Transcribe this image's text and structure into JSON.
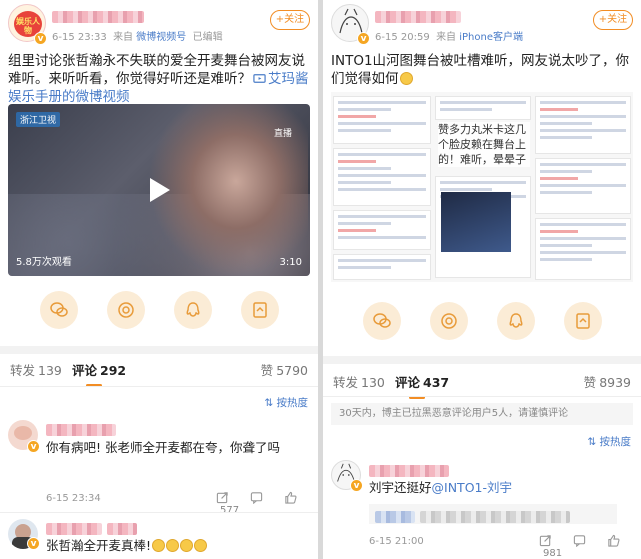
{
  "left": {
    "header": {
      "time": "6-15 23:33",
      "source_prefix": "来自",
      "source": "微博视频号",
      "edited": "已编辑",
      "follow": "+关注",
      "avatar_label": "娱乐人物"
    },
    "post": {
      "text": "组里讨论张哲瀚永不失联的爱全开麦舞台被网友说难听。来听听看，你觉得好听还是难听？",
      "link": "艾玛酱娱乐手册的微博视频"
    },
    "video": {
      "logo": "浙江卫视",
      "corner": "直播",
      "views": "5.8万次观看",
      "duration": "3:10"
    },
    "tabs": {
      "repost_label": "转发",
      "repost_count": "139",
      "comment_label": "评论",
      "comment_count": "292",
      "like_label": "赞",
      "like_count": "5790"
    },
    "sort_label": "按热度",
    "comments": [
      {
        "text": "你有病吧! 张老师全开麦都在夸，你聋了吗",
        "time": "6-15 23:34",
        "likes": "577"
      },
      {
        "text": "张哲瀚全开麦真棒!"
      }
    ]
  },
  "right": {
    "header": {
      "time": "6-15 20:59",
      "source_prefix": "来自",
      "source": "iPhone客户端",
      "follow": "+关注"
    },
    "post": {
      "text": "INTO1山河图舞台被吐槽难听，网友说太吵了，你们觉得如何"
    },
    "collage_text": "赞多力丸米卡这几个脸皮赖在舞台上的！难听，晕晕子",
    "tabs": {
      "repost_label": "转发",
      "repost_count": "130",
      "comment_label": "评论",
      "comment_count": "437",
      "like_label": "赞",
      "like_count": "8939"
    },
    "notice": "30天内，博主已拉黑恶意评论用户5人，请谨慎评论",
    "sort_label": "按热度",
    "comments": [
      {
        "text_prefix": "刘宇还挺好",
        "mention": "@INTO1-刘宇",
        "time": "6-15 21:00",
        "likes": "981"
      }
    ]
  },
  "colors": {
    "accent": "#f28d24",
    "link": "#4a7cc8",
    "share_bg": "#fbecd6",
    "share_icon": "#e89b3a"
  }
}
